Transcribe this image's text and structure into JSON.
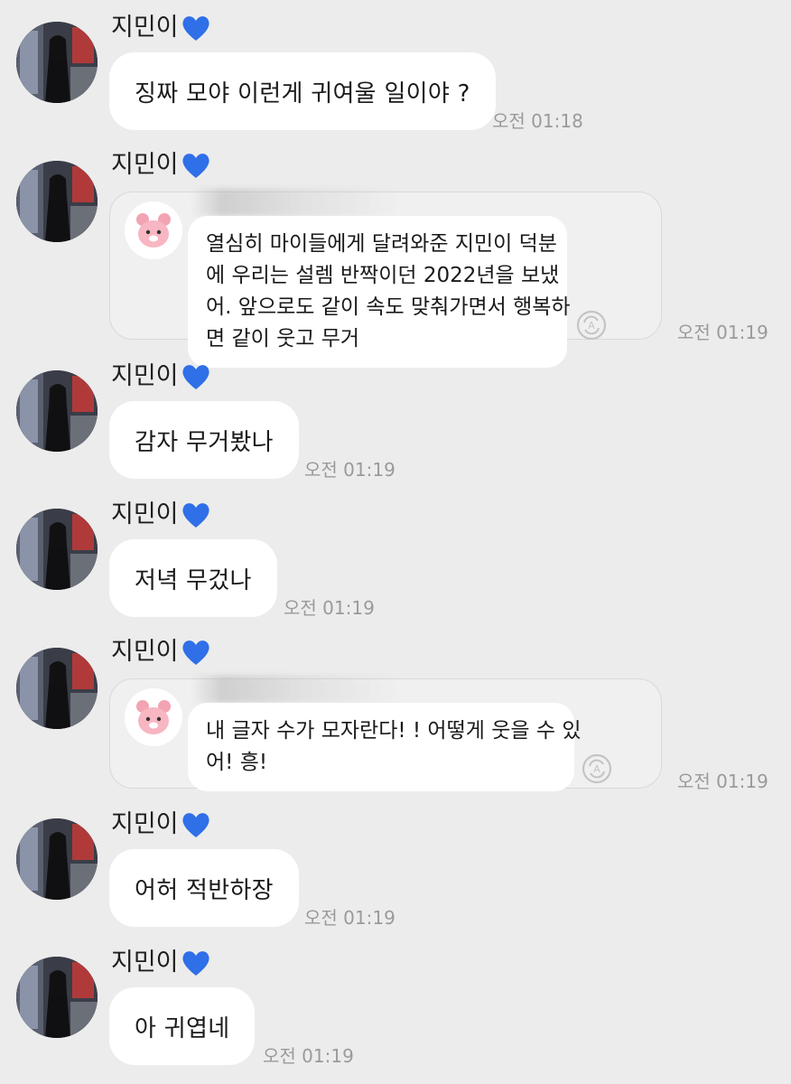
{
  "sender_name": "지민이",
  "messages": [
    {
      "type": "text",
      "text": "징짜 모야 이런게 귀여울 일이야 ?",
      "time": "오전 01:18"
    },
    {
      "type": "card",
      "lines": [
        "열심히 마이들에게 달려와준 지민이 덕분",
        "에 우리는 설렘 반짝이던 2022년을 보냈",
        "어. 앞으로도 같이 속도 맞춰가면서 행복하",
        "면 같이 웃고 무거"
      ],
      "time": "오전 01:19"
    },
    {
      "type": "text",
      "text": "감자 무거봤나",
      "time": "오전 01:19"
    },
    {
      "type": "text",
      "text": "저녁 무겄나",
      "time": "오전 01:19"
    },
    {
      "type": "card",
      "lines": [
        "내 글자 수가 모자란다! ! 어떻게 웃을 수 있",
        "어! 흥!"
      ],
      "time": "오전 01:19"
    },
    {
      "type": "text",
      "text": "어허 적반하장",
      "time": "오전 01:19"
    },
    {
      "type": "text",
      "text": "아 귀엽네",
      "time": "오전 01:19"
    }
  ],
  "colors": {
    "background": "#ececec",
    "bubble": "#ffffff",
    "heart": "#2f6fe8",
    "timestamp": "#9a9a9a"
  },
  "icons": {
    "heart": "blue-heart-icon",
    "translate": "translate-icon",
    "card_avatar": "pink-bear-icon"
  }
}
